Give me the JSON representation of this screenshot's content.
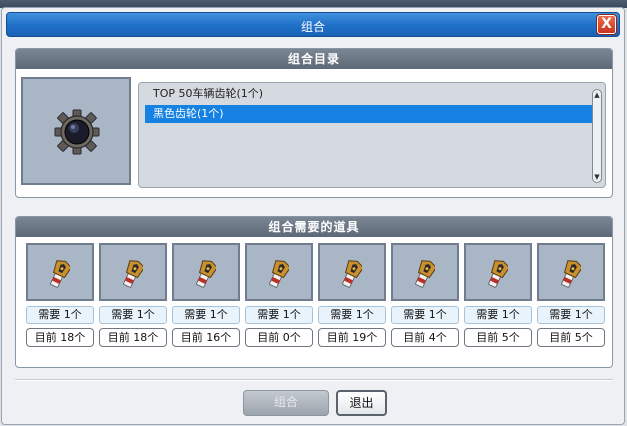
{
  "window": {
    "title": "组合",
    "close_label": "X"
  },
  "catalog": {
    "header": "组合目录",
    "preview_icon": "gear-icon",
    "items": [
      {
        "label": "TOP 50车辆齿轮(1个)",
        "selected": false
      },
      {
        "label": "黑色齿轮(1个)",
        "selected": true
      }
    ]
  },
  "requirements": {
    "header": "组合需要的道具",
    "item_icon": "component-icon",
    "slots": [
      {
        "need": "需要 1个",
        "have": "目前 18个"
      },
      {
        "need": "需要 1个",
        "have": "目前 18个"
      },
      {
        "need": "需要 1个",
        "have": "目前 16个"
      },
      {
        "need": "需要 1个",
        "have": "目前 0个"
      },
      {
        "need": "需要 1个",
        "have": "目前 19个"
      },
      {
        "need": "需要 1个",
        "have": "目前 4个"
      },
      {
        "need": "需要 1个",
        "have": "目前 5个"
      },
      {
        "need": "需要 1个",
        "have": "目前 5个"
      }
    ]
  },
  "buttons": {
    "combine_label": "组合",
    "combine_enabled": false,
    "exit_label": "退出"
  },
  "colors": {
    "titlebar": "#1f6fc8",
    "selection": "#1481e3",
    "close": "#c8321a",
    "slot_bg": "#a9b6c6"
  }
}
